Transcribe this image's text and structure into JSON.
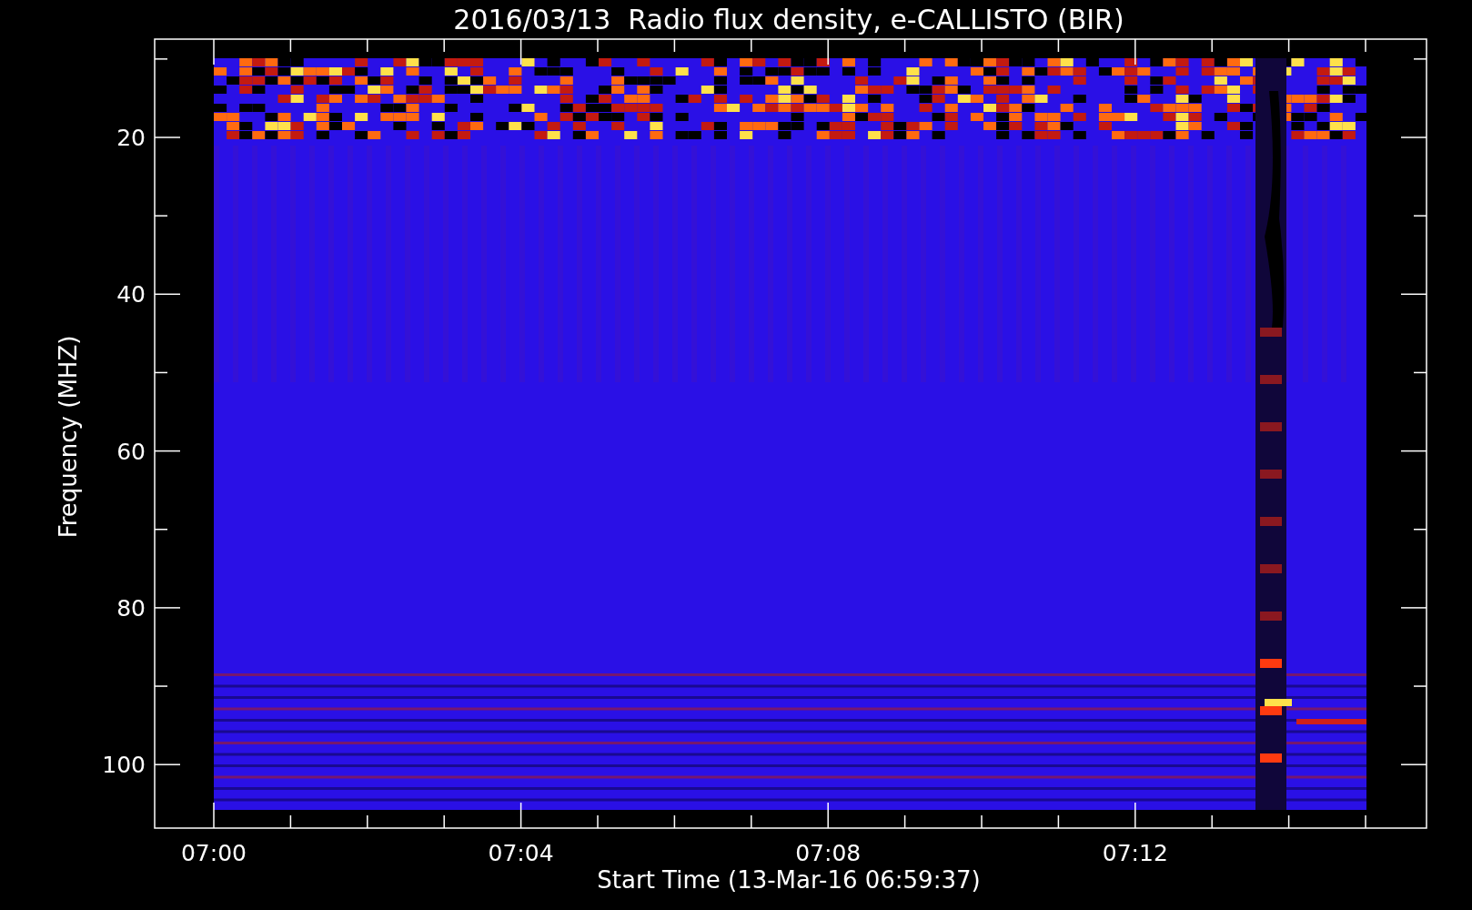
{
  "plot": {
    "title": "2016/03/13  Radio flux density, e-CALLISTO (BIR)",
    "xlabel": "Start Time (13-Mar-16 06:59:37)",
    "ylabel": "Frequency (MHZ)",
    "xticks": [
      "07:00",
      "07:04",
      "07:08",
      "07:12"
    ],
    "yticks": [
      "20",
      "40",
      "60",
      "80",
      "100"
    ]
  }
}
